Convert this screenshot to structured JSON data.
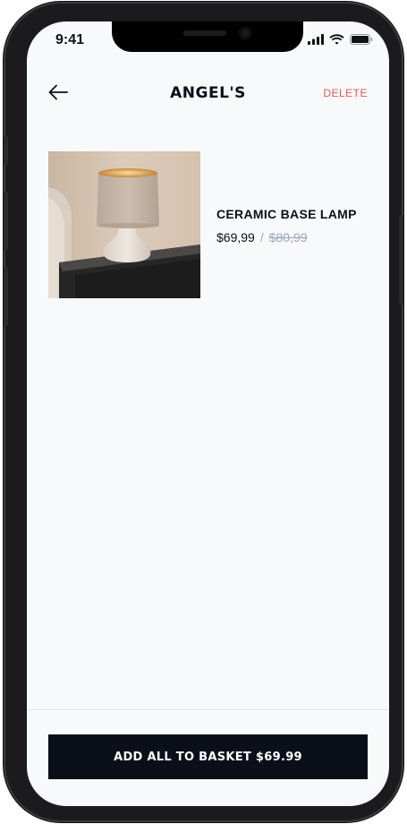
{
  "status_bar": {
    "time": "9:41"
  },
  "header": {
    "title": "ANGEL'S",
    "delete_label": "DELETE"
  },
  "items": [
    {
      "name": "CERAMIC BASE LAMP",
      "price": "$69,99",
      "separator": "/",
      "old_price": "$80,99"
    }
  ],
  "footer": {
    "button_label": "ADD ALL TO BASKET $69.99"
  },
  "colors": {
    "accent_delete": "#e05a57",
    "primary_dark": "#0b0f1a",
    "muted": "#9ba6bd",
    "background": "#f8f9fb"
  }
}
